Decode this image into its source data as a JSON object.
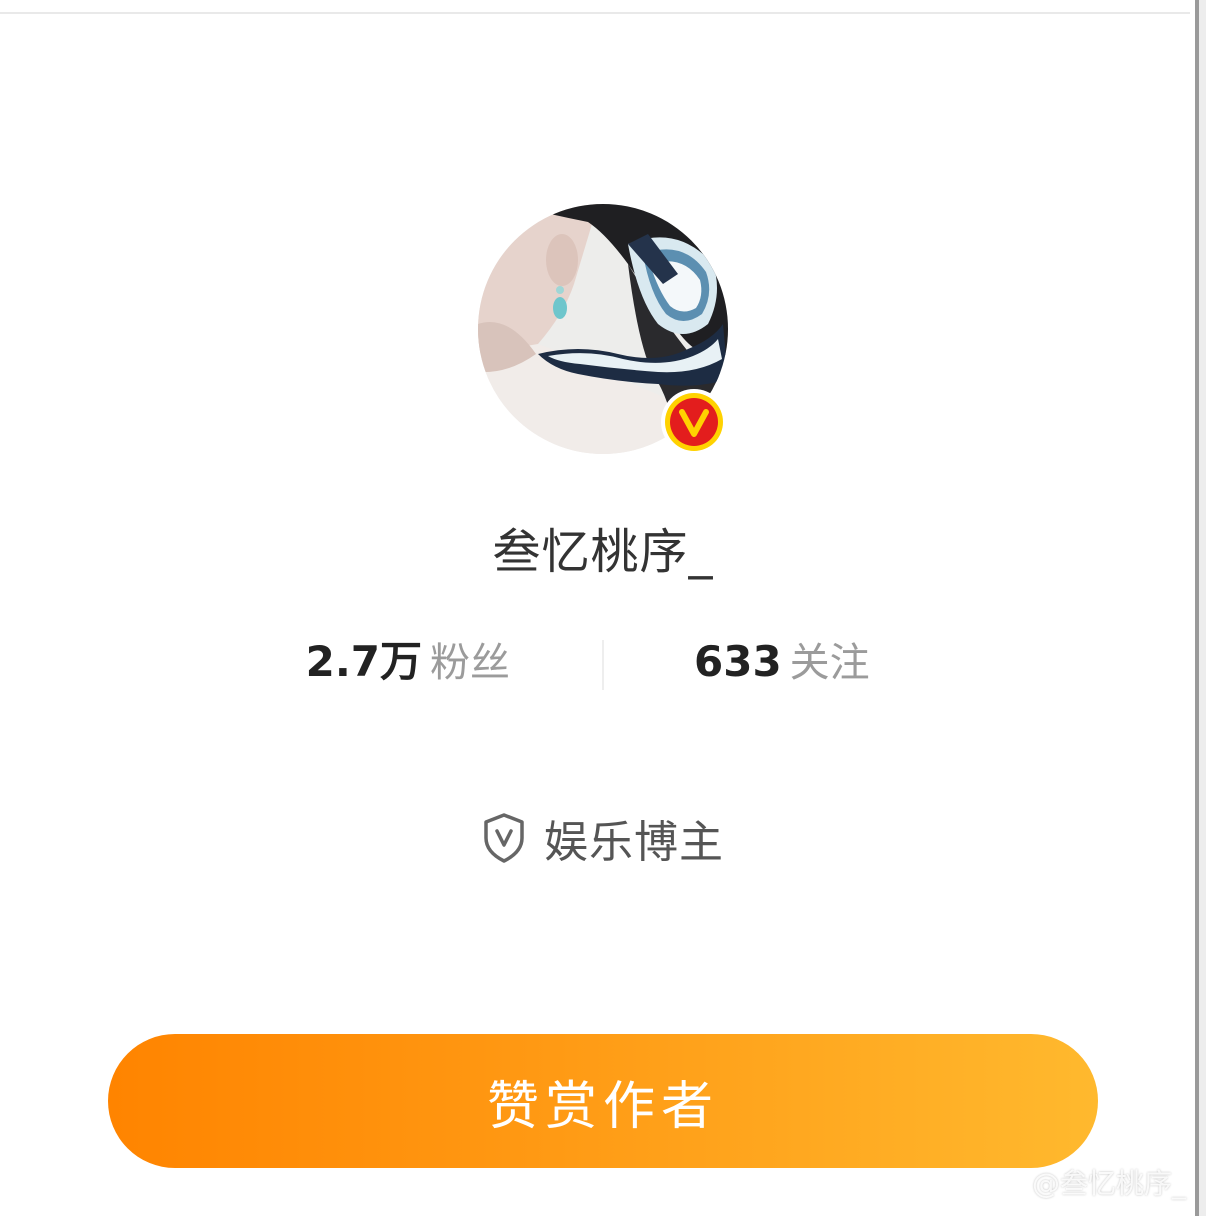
{
  "profile": {
    "username": "叁忆桃序_",
    "verified_icon": "verified-v-icon",
    "avatar_icon": "avatar-photo"
  },
  "stats": {
    "fans_value": "2.7万",
    "fans_label": "粉丝",
    "following_value": "633",
    "following_label": "关注"
  },
  "category": {
    "icon": "shield-v-icon",
    "label": "娱乐博主"
  },
  "actions": {
    "reward_label": "赞赏作者"
  },
  "watermark": {
    "text": "@叁忆桃序_"
  },
  "colors": {
    "button_gradient_start": "#ff8400",
    "button_gradient_end": "#ffb92e",
    "badge_red": "#e31d1d",
    "badge_ring": "#ffd200",
    "stat_label": "#9b9b9b"
  }
}
